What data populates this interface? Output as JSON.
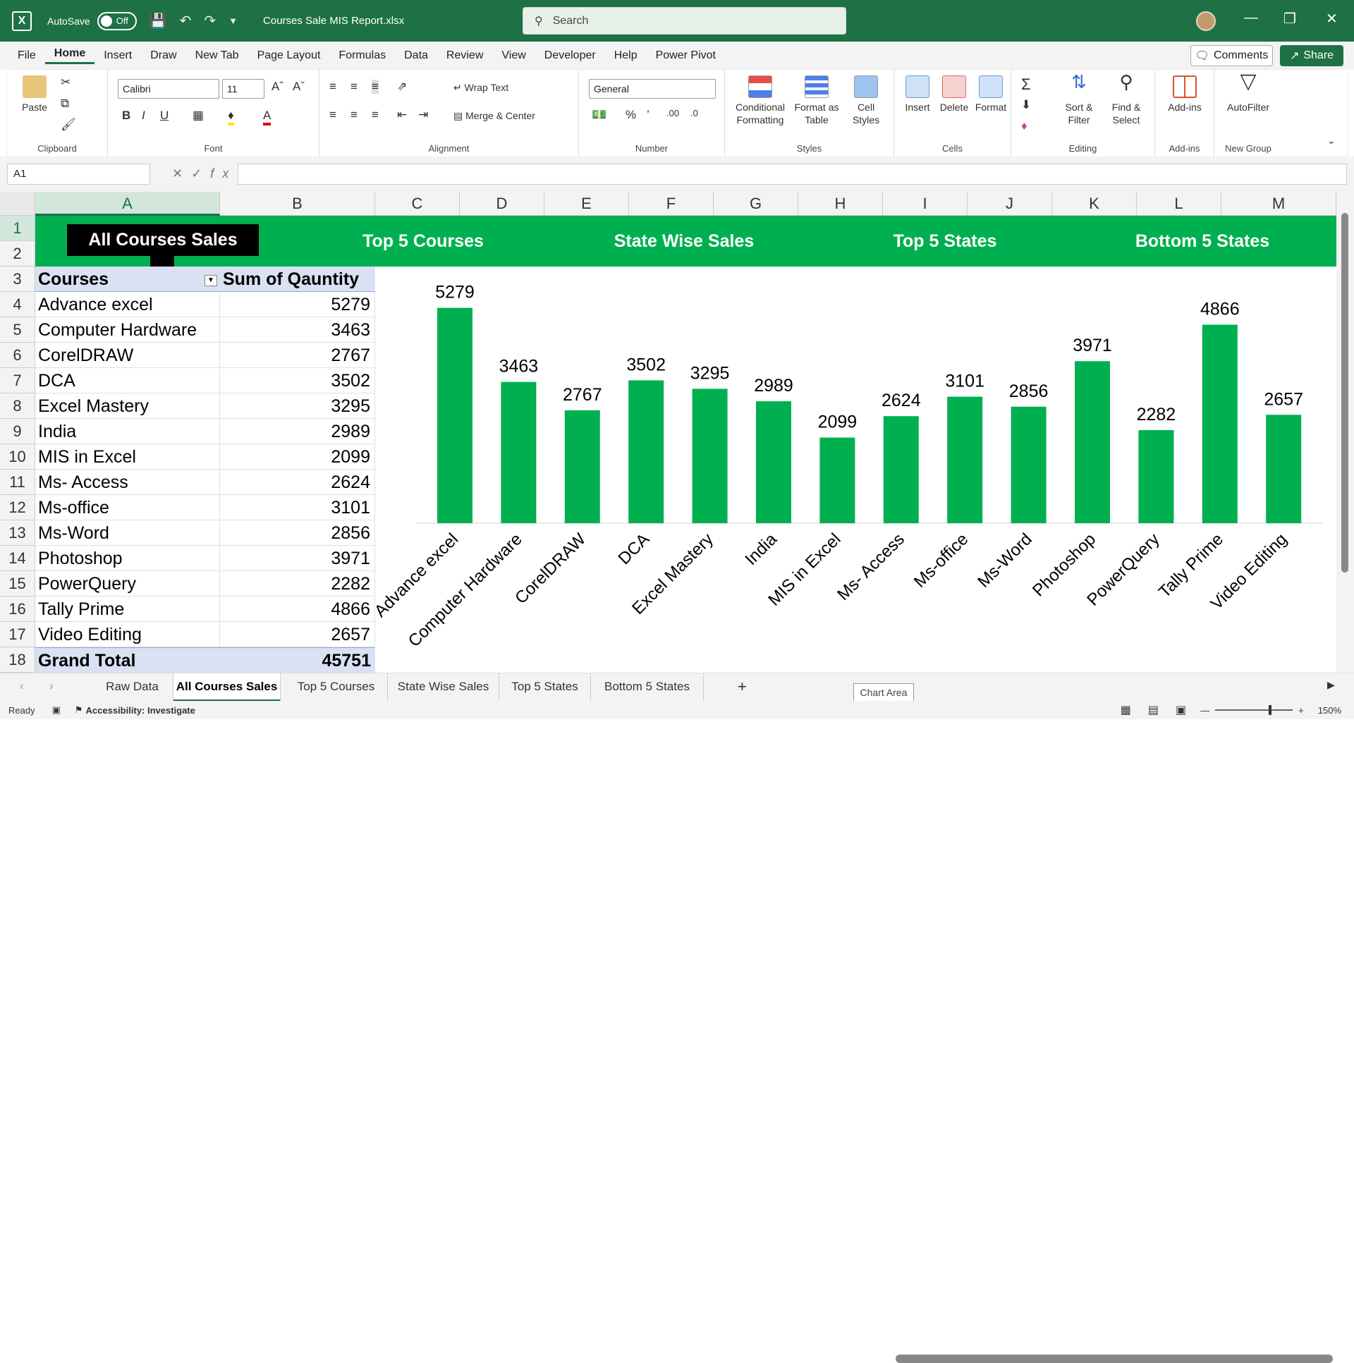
{
  "window": {
    "autosave_label": "AutoSave",
    "autosave_state": "Off",
    "doc_title": "Courses Sale MIS Report.xlsx",
    "search_placeholder": "Search"
  },
  "menu": {
    "items": [
      "File",
      "Home",
      "Insert",
      "Draw",
      "New Tab",
      "Page Layout",
      "Formulas",
      "Data",
      "Review",
      "View",
      "Developer",
      "Help",
      "Power Pivot"
    ],
    "active": "Home",
    "comments": "Comments",
    "share": "Share"
  },
  "ribbon": {
    "clipboard": {
      "paste": "Paste",
      "label": "Clipboard"
    },
    "font": {
      "name": "Calibri",
      "size": "11",
      "label": "Font"
    },
    "alignment": {
      "wrap": "Wrap Text",
      "merge": "Merge & Center",
      "label": "Alignment"
    },
    "number": {
      "format": "General",
      "label": "Number"
    },
    "styles": {
      "cond": "Conditional Formatting",
      "fmt_table": "Format as Table",
      "cell_styles": "Cell Styles",
      "label": "Styles"
    },
    "cells": {
      "insert": "Insert",
      "delete": "Delete",
      "format": "Format",
      "label": "Cells"
    },
    "editing": {
      "sort": "Sort & Filter",
      "find": "Find & Select",
      "label": "Editing"
    },
    "addins": {
      "btn": "Add-ins",
      "label": "Add-ins"
    },
    "newgroup": {
      "btn": "AutoFilter",
      "label": "New Group"
    }
  },
  "formula": {
    "namebox": "A1",
    "fx": "fx",
    "value": ""
  },
  "columns": [
    "A",
    "B",
    "C",
    "D",
    "E",
    "F",
    "G",
    "H",
    "I",
    "J",
    "K",
    "L",
    "M"
  ],
  "rows": [
    "1",
    "2",
    "3",
    "4",
    "5",
    "6",
    "7",
    "8",
    "9",
    "10",
    "11",
    "12",
    "13",
    "14",
    "15",
    "16",
    "17",
    "18"
  ],
  "nav": {
    "all_courses": "All Courses Sales",
    "top5_courses": "Top 5 Courses",
    "state_wise": "State Wise Sales",
    "top5_states": "Top 5 States",
    "bottom5_states": "Bottom 5 States"
  },
  "pivot": {
    "header_courses": "Courses",
    "header_sum": "Sum of Qauntity",
    "rows": [
      {
        "course": "Advance excel",
        "qty": "5279"
      },
      {
        "course": "Computer Hardware",
        "qty": "3463"
      },
      {
        "course": "CorelDRAW",
        "qty": "2767"
      },
      {
        "course": "DCA",
        "qty": "3502"
      },
      {
        "course": "Excel Mastery",
        "qty": "3295"
      },
      {
        "course": "India",
        "qty": "2989"
      },
      {
        "course": "MIS in Excel",
        "qty": "2099"
      },
      {
        "course": "Ms- Access",
        "qty": "2624"
      },
      {
        "course": "Ms-office",
        "qty": "3101"
      },
      {
        "course": "Ms-Word",
        "qty": "2856"
      },
      {
        "course": "Photoshop",
        "qty": "3971"
      },
      {
        "course": "PowerQuery",
        "qty": "2282"
      },
      {
        "course": "Tally Prime",
        "qty": "4866"
      },
      {
        "course": "Video Editing",
        "qty": "2657"
      }
    ],
    "total_label": "Grand Total",
    "total_value": "45751"
  },
  "chart_data": {
    "type": "bar",
    "categories": [
      "Advance excel",
      "Computer Hardware",
      "CorelDRAW",
      "DCA",
      "Excel Mastery",
      "India",
      "MIS in Excel",
      "Ms- Access",
      "Ms-office",
      "Ms-Word",
      "Photoshop",
      "PowerQuery",
      "Tally Prime",
      "Video Editing"
    ],
    "values": [
      5279,
      3463,
      2767,
      3502,
      3295,
      2989,
      2099,
      2624,
      3101,
      2856,
      3971,
      2282,
      4866,
      2657
    ],
    "title": "",
    "xlabel": "",
    "ylabel": "",
    "ylim": [
      0,
      5600
    ],
    "grid": false,
    "bar_color": "#00b050"
  },
  "sheets": {
    "tabs": [
      "Raw Data",
      "All Courses Sales",
      "Top 5 Courses",
      "State Wise Sales",
      "Top 5 States",
      "Bottom 5 States"
    ],
    "active": "All Courses Sales",
    "tooltip": "Chart Area"
  },
  "status": {
    "ready": "Ready",
    "accessibility": "Accessibility: Investigate",
    "zoom": "150%"
  },
  "colors": {
    "excel_green": "#1e7145",
    "nav_green": "#00b050",
    "pivot_header": "#d9e1f2"
  }
}
